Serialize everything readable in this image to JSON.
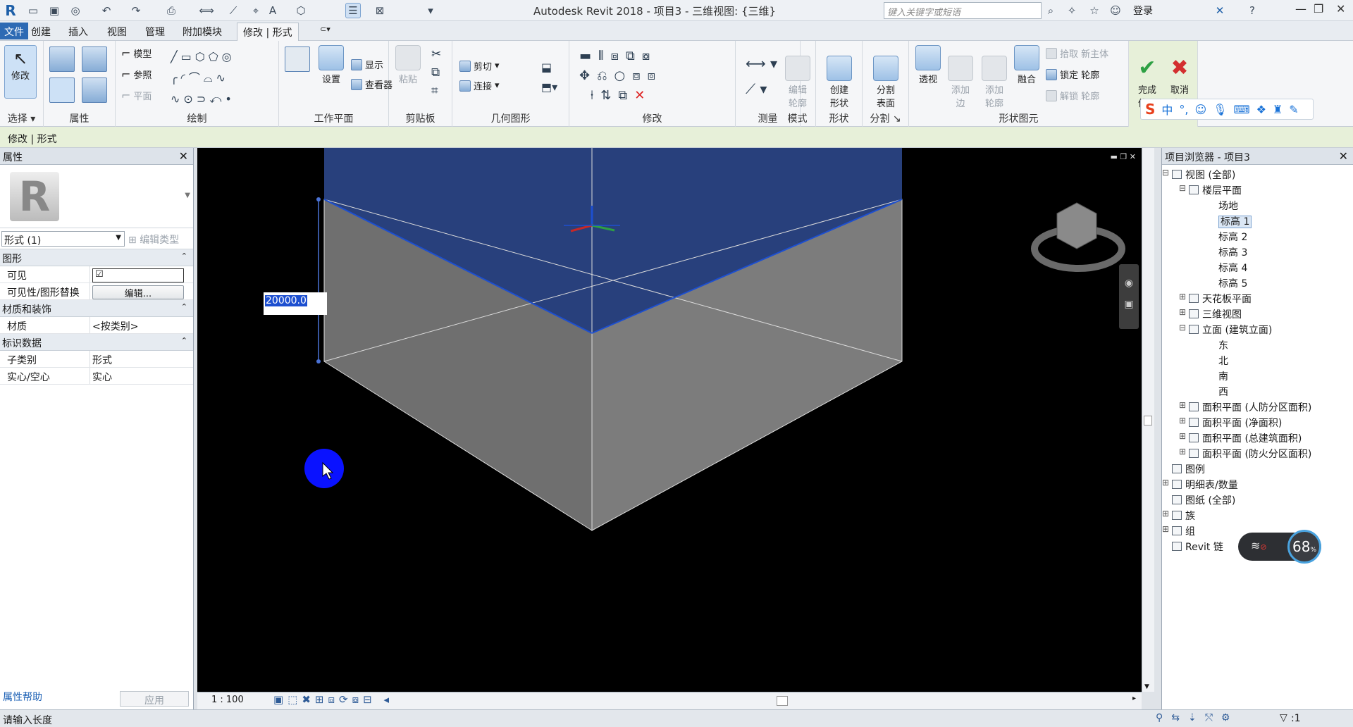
{
  "app": {
    "title": "Autodesk Revit 2018 -    项目3 - 三维视图: {三维}",
    "search_placeholder": "键入关键字或短语",
    "login": "登录"
  },
  "tabs": [
    "文件",
    "创建",
    "插入",
    "视图",
    "管理",
    "附加模块",
    "修改 | 形式"
  ],
  "ribbon": {
    "select": {
      "btn": "修改",
      "title": "选择 ▾"
    },
    "props": {
      "title": "属性"
    },
    "draw": {
      "model": "模型",
      "ref": "参照",
      "plane": "平面",
      "title": "绘制"
    },
    "workplane": {
      "set": "设置",
      "show": "显示",
      "viewer": "查看器",
      "title": "工作平面"
    },
    "clipboard": {
      "paste": "粘贴",
      "title": "剪贴板"
    },
    "geometry": {
      "cut": "剪切",
      "join": "连接",
      "title": "几何图形"
    },
    "modify": {
      "title": "修改"
    },
    "measure": {
      "title": "测量"
    },
    "mode": {
      "edit": "编辑\n轮廓",
      "title": "模式"
    },
    "shape": {
      "create": "创建\n形状",
      "title": "形状"
    },
    "divide": {
      "surface": "分割\n表面",
      "title": "分割"
    },
    "formel": {
      "xray": "透视",
      "addedge": "添加\n边",
      "addprofile": "添加\n轮廓",
      "blend": "融合",
      "pickhost": "拾取 新主体",
      "lockprofile": "锁定 轮廓",
      "unlockprofile": "解锁 轮廓",
      "title": "形状图元"
    },
    "inplace": {
      "finish": "完成\n体量",
      "cancel": "取消\n体量"
    }
  },
  "context_bar": "修改 | 形式",
  "properties": {
    "header": "属性",
    "type_selector": "形式 (1)",
    "edit_type": "编辑类型",
    "sections": [
      {
        "name": "图形",
        "rows": [
          {
            "k": "可见",
            "v": "☑"
          },
          {
            "k": "可见性/图形替换",
            "v": "编辑..."
          }
        ]
      },
      {
        "name": "材质和装饰",
        "rows": [
          {
            "k": "材质",
            "v": "<按类别>"
          }
        ]
      },
      {
        "name": "标识数据",
        "rows": [
          {
            "k": "子类别",
            "v": "形式"
          },
          {
            "k": "实心/空心",
            "v": "实心"
          }
        ]
      }
    ],
    "help": "属性帮助",
    "apply": "应用"
  },
  "viewport": {
    "dimension_input": "20000.0",
    "scale": "1 : 100"
  },
  "browser": {
    "header": "项目浏览器 - 项目3",
    "items": [
      {
        "label": "视图 (全部)",
        "level": 0,
        "exp": "⊟"
      },
      {
        "label": "楼层平面",
        "level": 1,
        "exp": "⊟"
      },
      {
        "label": "场地",
        "level": 2
      },
      {
        "label": "标高 1",
        "level": 2,
        "sel": true
      },
      {
        "label": "标高 2",
        "level": 2
      },
      {
        "label": "标高 3",
        "level": 2
      },
      {
        "label": "标高 4",
        "level": 2
      },
      {
        "label": "标高 5",
        "level": 2
      },
      {
        "label": "天花板平面",
        "level": 1,
        "exp": "⊞"
      },
      {
        "label": "三维视图",
        "level": 1,
        "exp": "⊞"
      },
      {
        "label": "立面 (建筑立面)",
        "level": 1,
        "exp": "⊟"
      },
      {
        "label": "东",
        "level": 2
      },
      {
        "label": "北",
        "level": 2
      },
      {
        "label": "南",
        "level": 2
      },
      {
        "label": "西",
        "level": 2
      },
      {
        "label": "面积平面 (人防分区面积)",
        "level": 1,
        "exp": "⊞"
      },
      {
        "label": "面积平面 (净面积)",
        "level": 1,
        "exp": "⊞"
      },
      {
        "label": "面积平面 (总建筑面积)",
        "level": 1,
        "exp": "⊞"
      },
      {
        "label": "面积平面 (防火分区面积)",
        "level": 1,
        "exp": "⊞"
      },
      {
        "label": "图例",
        "level": 0
      },
      {
        "label": "明细表/数量",
        "level": 0,
        "exp": "⊞"
      },
      {
        "label": "图纸 (全部)",
        "level": 0
      },
      {
        "label": "族",
        "level": 0,
        "exp": "⊞"
      },
      {
        "label": "组",
        "level": 0,
        "exp": "⊞"
      },
      {
        "label": "Revit 链",
        "level": 0
      }
    ],
    "net_badge": "68"
  },
  "status": {
    "text": "请输入长度",
    "filter": ":1"
  }
}
